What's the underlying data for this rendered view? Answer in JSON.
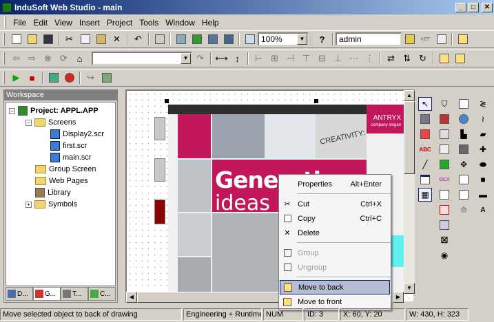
{
  "window": {
    "title": "InduSoft Web Studio - main",
    "min": "_",
    "max": "□",
    "close": "✕"
  },
  "menu": [
    "File",
    "Edit",
    "View",
    "Insert",
    "Project",
    "Tools",
    "Window",
    "Help"
  ],
  "toolbar": {
    "zoom": "100%",
    "user": "admin",
    "kef_label": "KEF"
  },
  "workspace": {
    "title": "Workspace",
    "tree": {
      "project": "Project: APPL.APP",
      "screens": "Screens",
      "screen_items": [
        "Display2.scr",
        "first.scr",
        "main.scr"
      ],
      "group_screen": "Group Screen",
      "web_pages": "Web Pages",
      "library": "Library",
      "symbols": "Symbols"
    },
    "tabs": [
      "D...",
      "G...",
      "T...",
      "C..."
    ]
  },
  "canvas": {
    "brand": "ANTRYX",
    "brand_sub": "company slogan",
    "headline1": "Generating",
    "headline2": "ideas",
    "word": "CREATIVITY:"
  },
  "context_menu": {
    "properties": "Properties",
    "properties_sc": "Alt+Enter",
    "cut": "Cut",
    "cut_sc": "Ctrl+X",
    "copy": "Copy",
    "copy_sc": "Ctrl+C",
    "delete": "Delete",
    "group": "Group",
    "ungroup": "Ungroup",
    "move_back": "Move to back",
    "move_front": "Move to front"
  },
  "status": {
    "message": "Move selected object to back of drawing",
    "mode": "Engineering + Runtime",
    "num": "NUM",
    "id": "ID: 3",
    "xy": "X: 60, Y: 20",
    "wh": "W: 430, H: 323"
  },
  "palette": {
    "abc": "ABC",
    "ocx": "OCX",
    "a": "A"
  },
  "colors": {
    "title_start": "#0a246a",
    "title_end": "#a6caf0",
    "magenta": "#c2185b",
    "cyan": "#5ff0f0",
    "highlight": "#b6bdd2"
  }
}
